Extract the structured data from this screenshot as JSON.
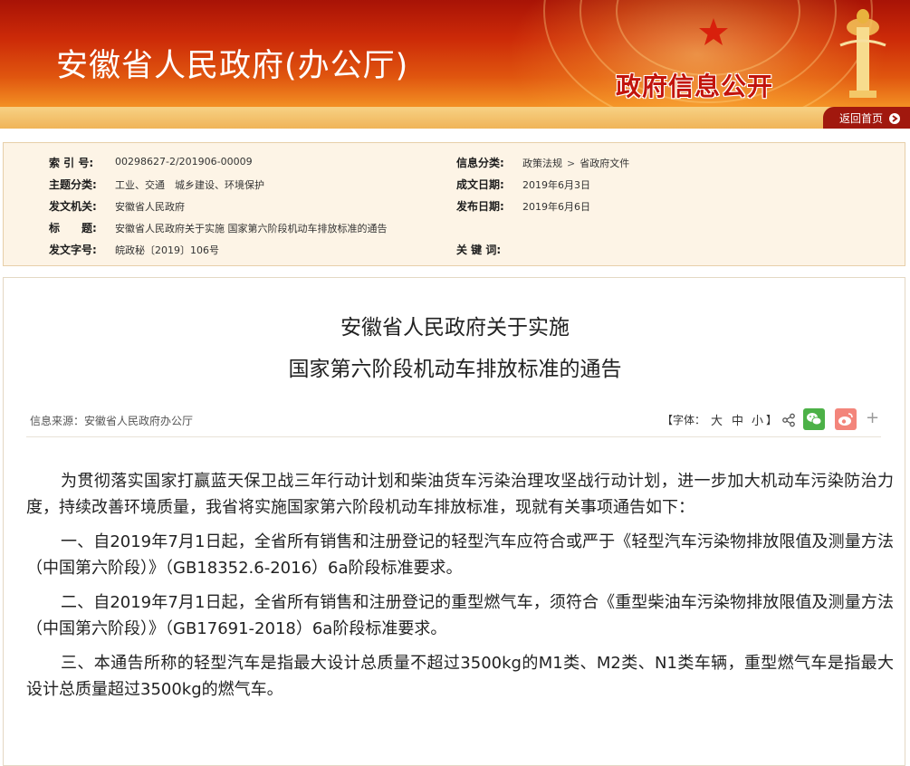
{
  "banner": {
    "site_title": "安徽省人民政府(办公厅)",
    "info_badge": "政府信息公开",
    "home_link": "返回首页"
  },
  "meta": {
    "left": [
      {
        "label": "索 引 号:",
        "value": "00298627-2/201906-00009"
      },
      {
        "label": "主题分类:",
        "value": "工业、交通　城乡建设、环境保护"
      },
      {
        "label": "发文机关:",
        "value": "安徽省人民政府"
      },
      {
        "label": "标　　题:",
        "value": "安徽省人民政府关于实施 国家第六阶段机动车排放标准的通告"
      },
      {
        "label": "发文字号:",
        "value": "皖政秘〔2019〕106号"
      }
    ],
    "right": [
      {
        "label": "信息分类:",
        "value_a": "政策法规",
        "value_b": "省政府文件"
      },
      {
        "label": "成文日期:",
        "value": "2019年6月3日"
      },
      {
        "label": "发布日期:",
        "value": "2019年6月6日"
      },
      {
        "label": "关 键 词:",
        "value": ""
      }
    ]
  },
  "article": {
    "title_line1": "安徽省人民政府关于实施",
    "title_line2": "国家第六阶段机动车排放标准的通告",
    "source": "信息来源：安徽省人民政府办公厅",
    "font_size": {
      "open": "【字体：",
      "large": "大",
      "medium": "中",
      "small": "小",
      "close": "】"
    },
    "more_icon": "plus-icon",
    "paragraphs": [
      "为贯彻落实国家打赢蓝天保卫战三年行动计划和柴油货车污染治理攻坚战行动计划，进一步加大机动车污染防治力度，持续改善环境质量，我省将实施国家第六阶段机动车排放标准，现就有关事项通告如下：",
      "一、自2019年7月1日起，全省所有销售和注册登记的轻型汽车应符合或严于《轻型汽车污染物排放限值及测量方法（中国第六阶段）》（GB18352.6-2016）6a阶段标准要求。",
      "二、自2019年7月1日起，全省所有销售和注册登记的重型燃气车，须符合《重型柴油车污染物排放限值及测量方法（中国第六阶段）》（GB17691-2018）6a阶段标准要求。",
      "三、本通告所称的轻型汽车是指最大设计总质量不超过3500kg的M1类、M2类、N1类车辆，重型燃气车是指最大设计总质量超过3500kg的燃气车。"
    ]
  },
  "colors": {
    "banner_red": "#c2140c",
    "banner_orange": "#f28d22",
    "meta_bg": "#fdf4e6",
    "wechat_green": "#4cb147",
    "weibo_pink": "#f3857b"
  }
}
